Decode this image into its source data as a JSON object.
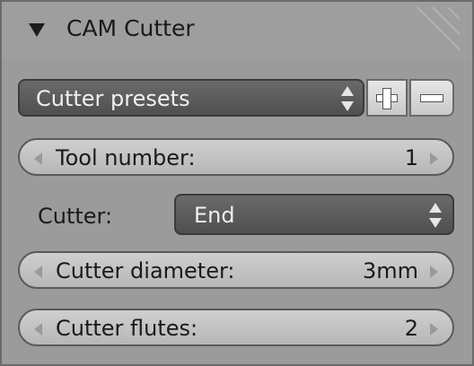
{
  "panel": {
    "title": "CAM Cutter"
  },
  "presets": {
    "label": "Cutter presets"
  },
  "fields": {
    "tool_number": {
      "label": "Tool number:",
      "value": "1"
    },
    "cutter_type": {
      "label": "Cutter:",
      "value": "End"
    },
    "cutter_diameter": {
      "label": "Cutter diameter:",
      "value": "3mm"
    },
    "cutter_flutes": {
      "label": "Cutter flutes:",
      "value": "2"
    }
  },
  "icons": {
    "collapse": "triangle-down-icon",
    "add": "plus-icon",
    "remove": "minus-icon",
    "updown": "up-down-arrows-icon",
    "left": "left-arrow-icon",
    "right": "right-arrow-icon"
  }
}
